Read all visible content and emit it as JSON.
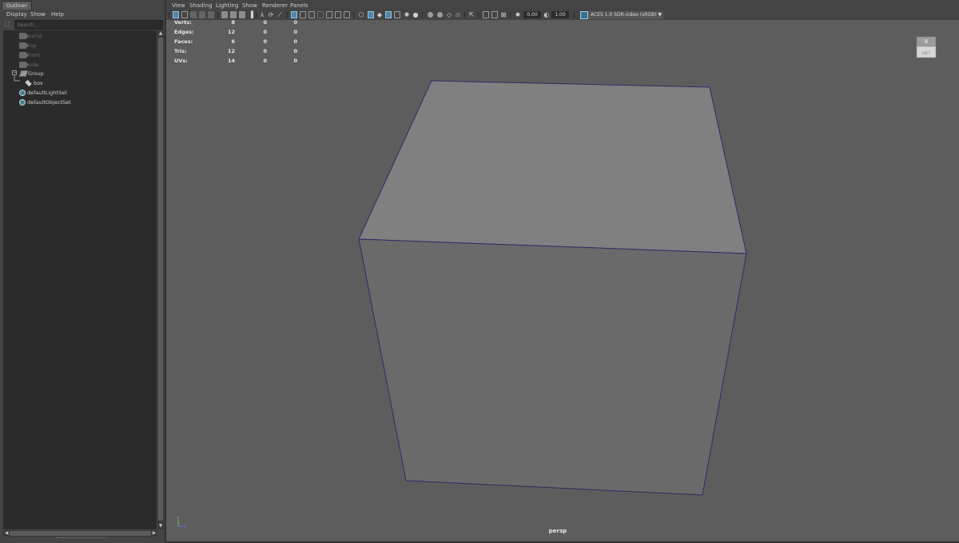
{
  "outliner": {
    "tab_label": "Outliner",
    "menu": [
      "Display",
      "Show",
      "Help"
    ],
    "search_placeholder": "Search...",
    "items": [
      {
        "label": "persp",
        "icon": "camera-icon",
        "state": "dim"
      },
      {
        "label": "top",
        "icon": "camera-icon",
        "state": "dim"
      },
      {
        "label": "front",
        "icon": "camera-icon",
        "state": "dim"
      },
      {
        "label": "side",
        "icon": "camera-icon",
        "state": "dim"
      },
      {
        "label": "Group",
        "icon": "group-transform-icon",
        "state": "lit"
      },
      {
        "label": "box",
        "icon": "mesh-icon",
        "state": "lit"
      },
      {
        "label": "defaultLightSet",
        "icon": "set-icon",
        "state": "lit"
      },
      {
        "label": "defaultObjectSet",
        "icon": "set-icon",
        "state": "lit"
      }
    ],
    "expander_glyph": "−"
  },
  "viewport": {
    "menu": [
      "View",
      "Shading",
      "Lighting",
      "Show",
      "Renderer",
      "Panels"
    ],
    "exposure": "0.00",
    "gamma": "1.00",
    "color_space": "ACES 1.0 SDR-video (sRGB)",
    "camera_name": "persp",
    "viewcube_labels": {
      "top": "B",
      "front": "LEFT"
    },
    "axis_labels": {
      "y": "Y",
      "z": "Z"
    },
    "hud": {
      "rows": [
        {
          "label": "Verts:",
          "values": [
            "8",
            "0",
            "0"
          ]
        },
        {
          "label": "Edges:",
          "values": [
            "12",
            "0",
            "0"
          ]
        },
        {
          "label": "Faces:",
          "values": [
            "6",
            "0",
            "0"
          ]
        },
        {
          "label": "Tris:",
          "values": [
            "12",
            "0",
            "0"
          ]
        },
        {
          "label": "UVs:",
          "values": [
            "14",
            "0",
            "0"
          ]
        }
      ]
    },
    "colors": {
      "viewport_bg": "#5d5d5d",
      "cube_top": "#808080",
      "cube_front": "#6a6a6a",
      "cube_edge": "#2c2c66",
      "accent": "#5285a6"
    }
  }
}
